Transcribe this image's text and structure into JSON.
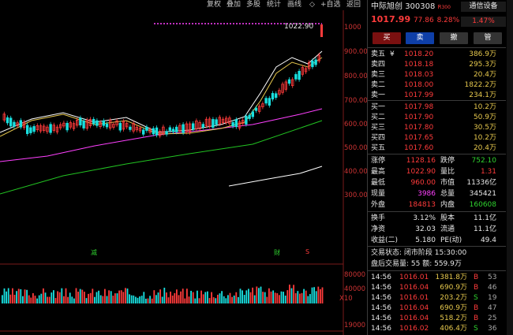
{
  "toolbar": {
    "items": [
      "复权",
      "叠加",
      "多股",
      "统计",
      "画线",
      "◇",
      "+自选",
      "返回"
    ]
  },
  "chart": {
    "price_labels": [
      "1000",
      "900.00",
      "800.00",
      "700.00",
      "600.00",
      "500.00",
      "400.00",
      "300.00"
    ],
    "vol_labels": [
      "80000",
      "40000",
      "X10",
      "19000"
    ],
    "annotation": "1022.90",
    "markers": [
      "减",
      "财",
      "S"
    ],
    "colors": {
      "up": "#ff3b3b",
      "down": "#19e0e0",
      "ma5": "#ffffff",
      "ma10": "#e6c84d",
      "ma20": "#ff40ff",
      "ma60": "#22c322"
    }
  },
  "panel": {
    "name": "中际旭创",
    "code": "300308",
    "badge": "R",
    "badge_sub": "300",
    "price": "1017.99",
    "change": "77.86",
    "pct": "8.28%",
    "settings_label": "通信设备",
    "settings_pct": "1.47%",
    "buttons": [
      "买",
      "卖",
      "撤",
      "管"
    ],
    "asks": [
      {
        "label": "卖五",
        "flag": "¥",
        "price": "1018.20",
        "vol": "386.9万"
      },
      {
        "label": "卖四",
        "flag": "",
        "price": "1018.18",
        "vol": "295.3万"
      },
      {
        "label": "卖三",
        "flag": "",
        "price": "1018.03",
        "vol": "20.4万"
      },
      {
        "label": "卖二",
        "flag": "",
        "price": "1018.00",
        "vol": "1822.2万"
      },
      {
        "label": "卖一",
        "flag": "",
        "price": "1017.99",
        "vol": "234.1万"
      }
    ],
    "bids": [
      {
        "label": "买一",
        "price": "1017.98",
        "vol": "10.2万"
      },
      {
        "label": "买二",
        "price": "1017.90",
        "vol": "50.9万"
      },
      {
        "label": "买三",
        "price": "1017.80",
        "vol": "30.5万"
      },
      {
        "label": "买四",
        "price": "1017.65",
        "vol": "10.2万"
      },
      {
        "label": "买五",
        "price": "1017.60",
        "vol": "20.4万"
      }
    ],
    "stats": [
      {
        "l1": "涨停",
        "v1": "1128.16",
        "c1": "red",
        "l2": "跌停",
        "v2": "752.10",
        "c2": "grn"
      },
      {
        "l1": "最高",
        "v1": "1022.90",
        "c1": "red",
        "l2": "量比",
        "v2": "1.31",
        "c2": "red"
      },
      {
        "l1": "最低",
        "v1": "960.00",
        "c1": "red",
        "l2": "市值",
        "v2": "11336亿",
        "c2": "wht"
      },
      {
        "l1": "现量",
        "v1": "3986",
        "c1": "mag",
        "l2": "总量",
        "v2": "345421",
        "c2": "wht"
      },
      {
        "l1": "外盘",
        "v1": "184813",
        "c1": "red",
        "l2": "内盘",
        "v2": "160608",
        "c2": "grn"
      }
    ],
    "stats2": [
      {
        "l1": "换手",
        "v1": "3.12%",
        "l2": "股本",
        "v2": "11.1亿"
      },
      {
        "l1": "净资",
        "v1": "32.03",
        "l2": "流通",
        "v2": "11.1亿"
      },
      {
        "l1": "收益(二)",
        "v1": "5.180",
        "l2": "PE(动)",
        "v2": "49.4"
      }
    ],
    "trade_status": "交易状态: 闭市阶段 15:30:00",
    "after_hours": "盘后交易量: 55  额: 559.9万",
    "ticks": [
      {
        "time": "14:56",
        "price": "1016.01",
        "vol": "1381.8万",
        "side": "B",
        "n": "53"
      },
      {
        "time": "14:56",
        "price": "1016.04",
        "vol": "690.9万",
        "side": "B",
        "n": "46"
      },
      {
        "time": "14:56",
        "price": "1016.01",
        "vol": "203.2万",
        "side": "S",
        "n": "19"
      },
      {
        "time": "14:56",
        "price": "1016.04",
        "vol": "690.9万",
        "side": "B",
        "n": "47"
      },
      {
        "time": "14:56",
        "price": "1016.04",
        "vol": "518.2万",
        "side": "B",
        "n": "25"
      },
      {
        "time": "14:56",
        "price": "1016.02",
        "vol": "406.4万",
        "side": "S",
        "n": "36"
      }
    ]
  }
}
